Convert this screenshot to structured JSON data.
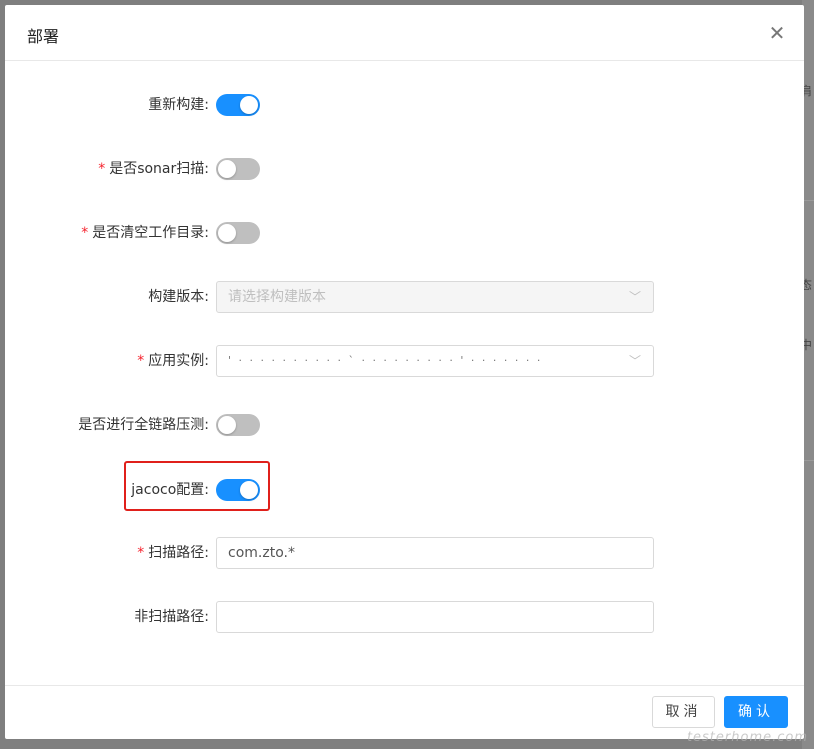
{
  "dialog": {
    "title": "部署",
    "close_icon": "close-icon"
  },
  "form": {
    "rebuild": {
      "label": "重新构建:",
      "required": false,
      "on": true
    },
    "sonar": {
      "label": "是否sonar扫描:",
      "required": true,
      "on": false
    },
    "clean_dir": {
      "label": "是否清空工作目录:",
      "required": true,
      "on": false
    },
    "build_version": {
      "label": "构建版本:",
      "required": false,
      "placeholder": "请选择构建版本",
      "disabled": true
    },
    "app_instance": {
      "label": "应用实例:",
      "required": true,
      "value": "' · · · · · · · · · · ` · · · · · · · · · ' · · · · · · ·"
    },
    "full_link_test": {
      "label": "是否进行全链路压测:",
      "required": false,
      "on": false
    },
    "jacoco": {
      "label": "jacoco配置:",
      "required": false,
      "on": true
    },
    "scan_path": {
      "label": "扫描路径:",
      "required": true,
      "value": "com.zto.*"
    },
    "exclude_path": {
      "label": "非扫描路径:",
      "required": false,
      "value": ""
    }
  },
  "footer": {
    "cancel_label": "取消",
    "ok_label": "确认"
  },
  "background": {
    "char1": "肩",
    "char2": "态",
    "char3": "中"
  },
  "watermark": "testerhome.com",
  "colors": {
    "primary": "#1890ff",
    "required": "#f5222d",
    "highlight": "#e0201b"
  }
}
